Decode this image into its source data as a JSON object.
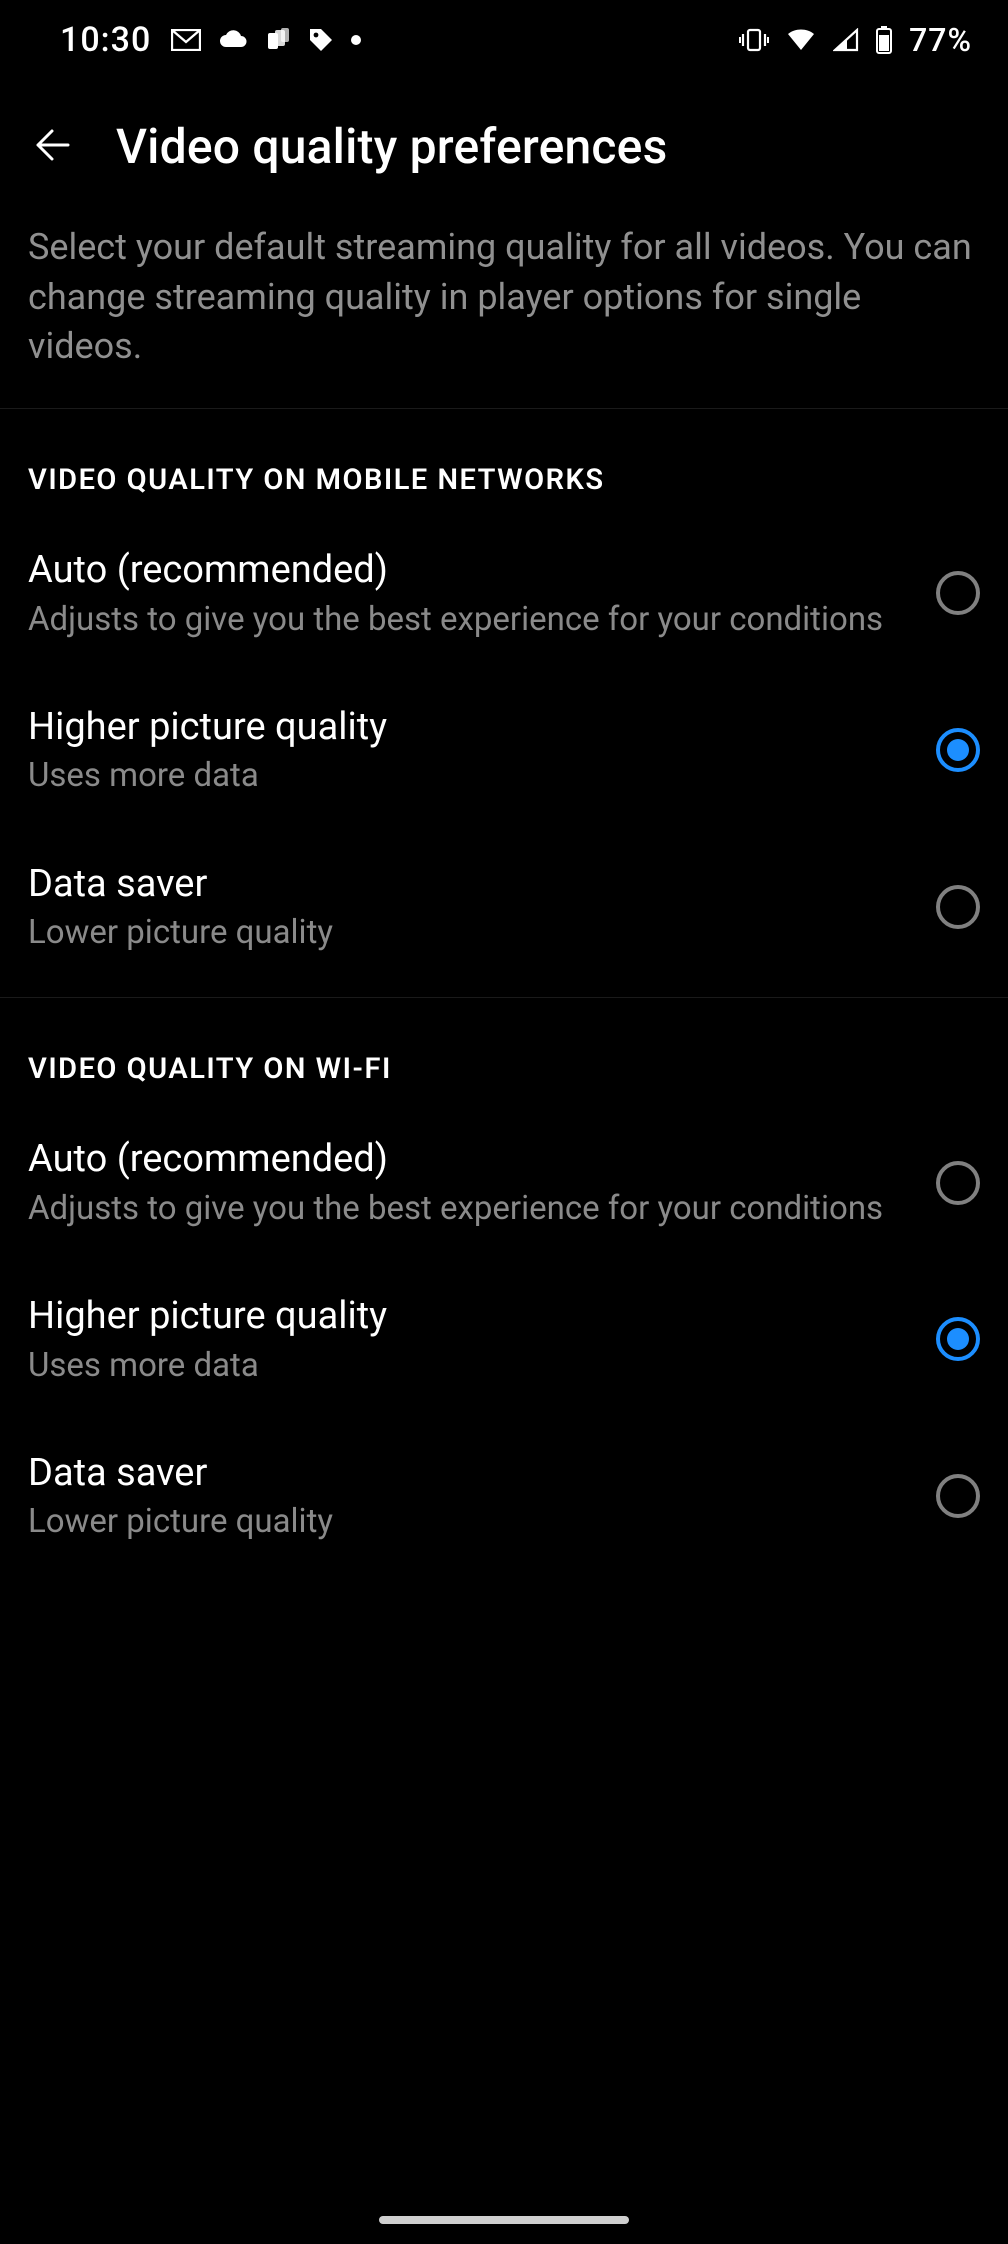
{
  "status_bar": {
    "time": "10:30",
    "battery_text": "77%"
  },
  "header": {
    "title": "Video quality preferences"
  },
  "description": "Select your default streaming quality for all videos. You can change streaming quality in player options for single videos.",
  "sections": {
    "mobile": {
      "label": "VIDEO QUALITY ON MOBILE NETWORKS",
      "options": [
        {
          "title": "Auto (recommended)",
          "sub": "Adjusts to give you the best experience for your conditions",
          "selected": false
        },
        {
          "title": "Higher picture quality",
          "sub": "Uses more data",
          "selected": true
        },
        {
          "title": "Data saver",
          "sub": "Lower picture quality",
          "selected": false
        }
      ]
    },
    "wifi": {
      "label": "VIDEO QUALITY ON WI-FI",
      "options": [
        {
          "title": "Auto (recommended)",
          "sub": "Adjusts to give you the best experience for your conditions",
          "selected": false
        },
        {
          "title": "Higher picture quality",
          "sub": "Uses more data",
          "selected": true
        },
        {
          "title": "Data saver",
          "sub": "Lower picture quality",
          "selected": false
        }
      ]
    }
  }
}
